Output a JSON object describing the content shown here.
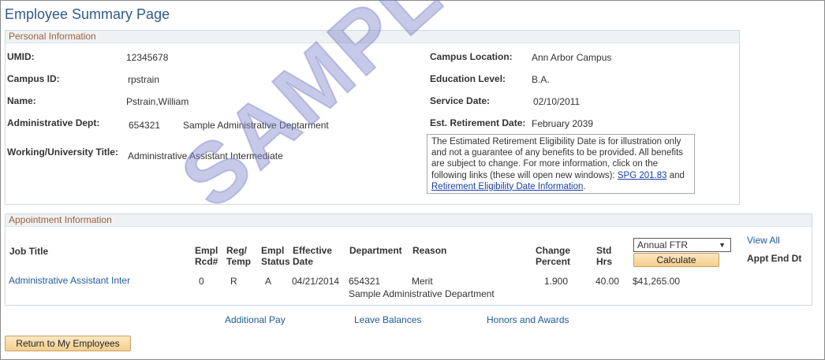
{
  "page": {
    "title": "Employee Summary Page"
  },
  "personal": {
    "header": "Personal Information",
    "umid_label": "UMID:",
    "umid": "12345678",
    "campus_id_label": "Campus ID:",
    "campus_id": "rpstrain",
    "name_label": "Name:",
    "name": "Pstrain,William",
    "admin_dept_label": "Administrative Dept:",
    "admin_dept_code": "654321",
    "admin_dept_name": "Sample Administrative Deptarment",
    "title_label": "Working/University Title:",
    "title": "Administrative Assistant Intermediate",
    "campus_location_label": "Campus Location:",
    "campus_location": "Ann Arbor Campus",
    "education_label": "Education Level:",
    "education": "B.A.",
    "service_date_label": "Service Date:",
    "service_date": "02/10/2011",
    "retirement_label": "Est. Retirement Date:",
    "retirement": "February 2039",
    "note_text": "The Estimated Retirement Eligibility Date is for illustration only and not a guarantee of any benefits to be provided. All benefits are subject to change. For more information, click on the following links (these will open new windows): ",
    "note_link1": "SPG 201.83",
    "note_and": " and ",
    "note_link2": "Retirement Eligibility Date Information",
    "note_end": "."
  },
  "appointment": {
    "header": "Appointment Information",
    "columns": {
      "job_title": "Job Title",
      "empl_rcd_1": "Empl",
      "empl_rcd_2": "Rcd#",
      "reg_temp_1": "Reg/",
      "reg_temp_2": "Temp",
      "empl_status_1": "Empl",
      "empl_status_2": "Status",
      "effective_1": "Effective",
      "effective_2": "Date",
      "department": "Department",
      "reason": "Reason",
      "change_1": "Change",
      "change_2": "Percent",
      "std_1": "Std",
      "std_2": "Hrs",
      "appt_end": "Appt End Dt"
    },
    "select_value": "Annual FTR",
    "calculate_label": "Calculate",
    "view_all": "View All",
    "row": {
      "job_title": "Administrative Assistant Inter",
      "empl_rcd": "0",
      "reg_temp": "R",
      "empl_status": "A",
      "effective_date": "04/21/2014",
      "dept_code": "654321",
      "dept_name": "Sample Administrative Department",
      "reason": "Merit",
      "change_percent": "1.900",
      "std_hrs": "40.00",
      "annual": "$41,265.00"
    }
  },
  "links": {
    "additional_pay": "Additional Pay",
    "leave_balances": "Leave Balances",
    "honors_awards": "Honors and Awards"
  },
  "return_button": "Return to My Employees",
  "watermark": "SAMPLE"
}
